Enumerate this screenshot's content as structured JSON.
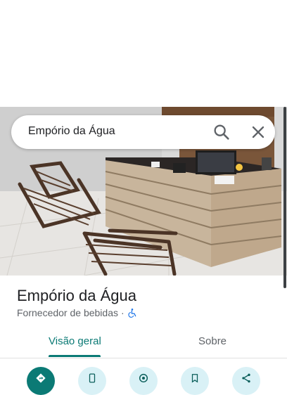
{
  "search": {
    "query": "Empório da Água"
  },
  "place": {
    "name": "Empório da Água",
    "category": "Fornecedor de bebidas",
    "separator": "·"
  },
  "tabs": [
    {
      "label": "Visão geral",
      "selected": true
    },
    {
      "label": "Sobre",
      "selected": false
    }
  ],
  "actions": [
    {
      "icon": "directions-icon"
    },
    {
      "icon": "phone-icon"
    },
    {
      "icon": "nearby-icon"
    },
    {
      "icon": "save-icon"
    },
    {
      "icon": "share-icon"
    }
  ],
  "colors": {
    "accent": "#0b7a75",
    "action_bg": "#d9f1f6",
    "text_primary": "#202124",
    "text_secondary": "#5f6368"
  }
}
